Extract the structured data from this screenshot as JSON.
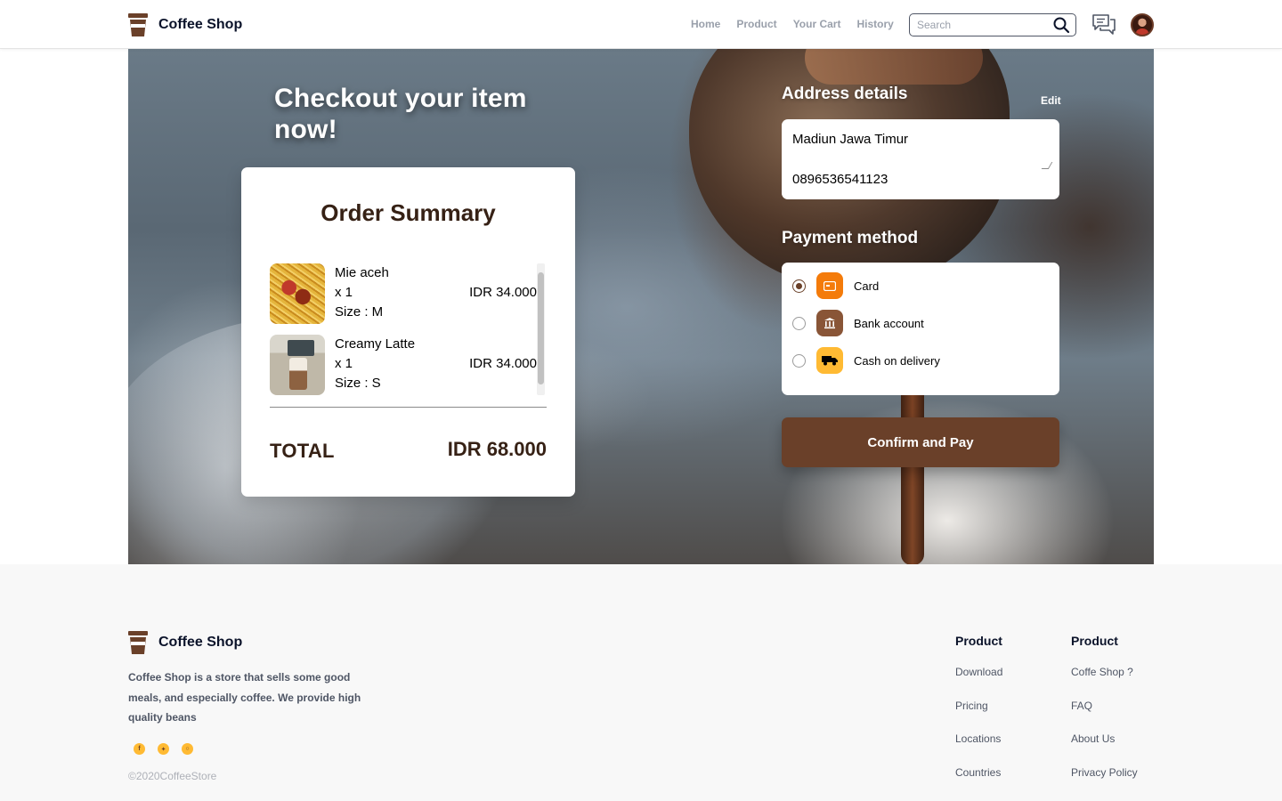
{
  "nav": {
    "brand": "Coffee Shop",
    "links": [
      "Home",
      "Product",
      "Your Cart",
      "History"
    ],
    "search_placeholder": "Search"
  },
  "hero": {
    "title": "Checkout your item now!"
  },
  "summary": {
    "title": "Order Summary",
    "items": [
      {
        "name": "Mie aceh",
        "qty": "x 1",
        "size": "Size : M",
        "price": "IDR 34.000"
      },
      {
        "name": "Creamy Latte",
        "qty": "x 1",
        "size": "Size : S",
        "price": "IDR 34.000"
      }
    ],
    "total_label": "TOTAL",
    "total_value": "IDR 68.000"
  },
  "address": {
    "title": "Address details",
    "edit_label": "Edit",
    "line": "Madiun Jawa Timur",
    "phone": "0896536541123"
  },
  "payment": {
    "title": "Payment method",
    "options": [
      {
        "label": "Card",
        "icon": "card-icon",
        "color": "#f47b0a",
        "selected": true
      },
      {
        "label": "Bank account",
        "icon": "bank-icon",
        "color": "#895537",
        "selected": false
      },
      {
        "label": "Cash on delivery",
        "icon": "truck-icon",
        "color": "#ffba33",
        "selected": false
      }
    ],
    "confirm_label": "Confirm and Pay"
  },
  "footer": {
    "brand": "Coffee Shop",
    "description": "Coffee Shop is a store that sells some good meals, and especially coffee. We provide high quality beans",
    "socials": [
      "facebook-icon",
      "twitter-icon",
      "instagram-icon"
    ],
    "copyright": "©2020CoffeeStore",
    "columns": [
      {
        "title": "Product",
        "links": [
          "Download",
          "Pricing",
          "Locations",
          "Countries"
        ]
      },
      {
        "title": "Product",
        "links": [
          "Coffe Shop ?",
          "FAQ",
          "About Us",
          "Privacy Policy"
        ]
      }
    ]
  },
  "colors": {
    "brand_brown": "#6a4029",
    "dark_text": "#362115",
    "accent_yellow": "#ffba33",
    "card_orange": "#f47b0a"
  }
}
